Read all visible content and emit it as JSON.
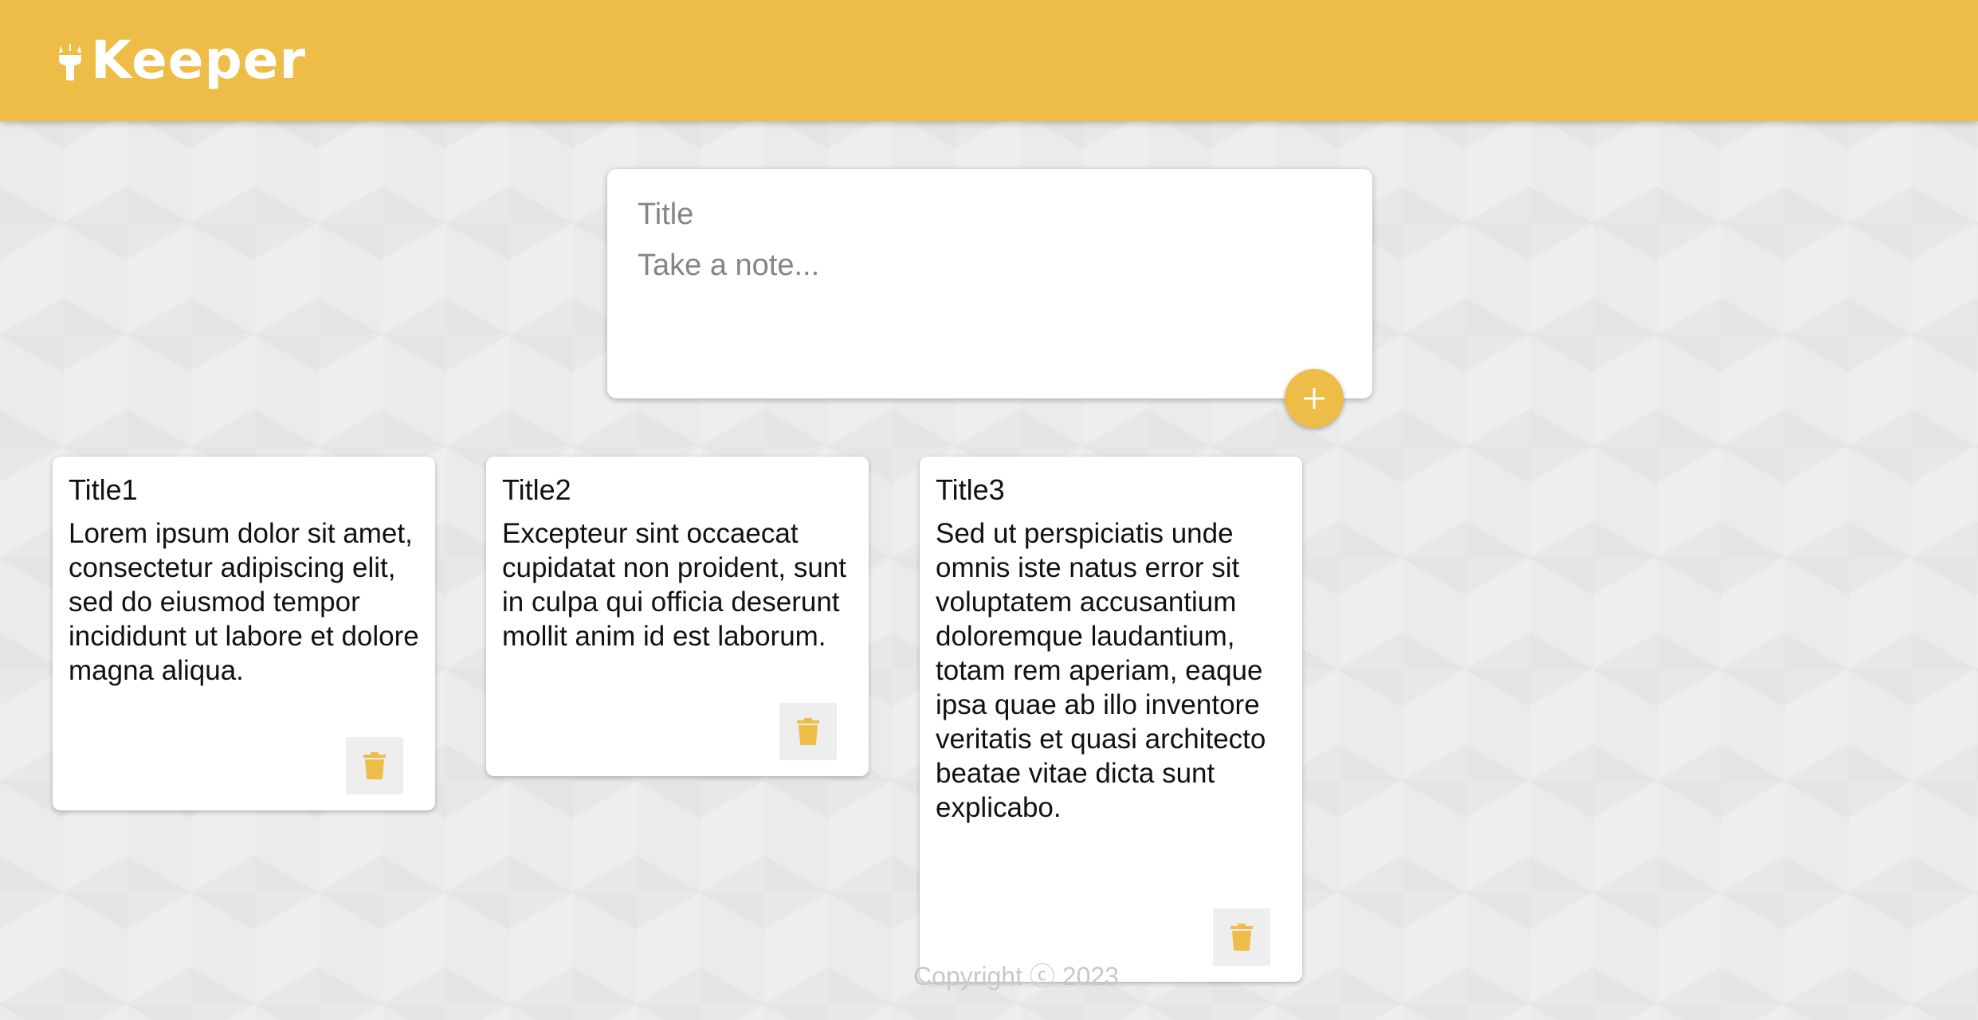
{
  "header": {
    "app_name": "Keeper",
    "logo_icon": "highlight-flashlight-icon",
    "background_color": "#edbd47"
  },
  "create_note": {
    "title_placeholder": "Title",
    "content_placeholder": "Take a note...",
    "title_value": "",
    "content_value": "",
    "add_icon": "plus-icon"
  },
  "notes": [
    {
      "title": "Title1",
      "content": "Lorem ipsum dolor sit amet, consectetur adipiscing elit, sed do eiusmod tempor incididunt ut labore et dolore magna aliqua.",
      "delete_icon": "trash-icon"
    },
    {
      "title": "Title2",
      "content": "Excepteur sint occaecat cupidatat non proident, sunt in culpa qui officia deserunt mollit anim id est laborum.",
      "delete_icon": "trash-icon"
    },
    {
      "title": "Title3",
      "content": "Sed ut perspiciatis unde omnis iste natus error sit voluptatem accusantium doloremque laudantium, totam rem aperiam, eaque ipsa quae ab illo inventore veritatis et quasi architecto beatae vitae dicta sunt explicabo.",
      "delete_icon": "trash-icon"
    }
  ],
  "footer": {
    "copyright": "Copyright ⓒ 2023"
  },
  "colors": {
    "accent": "#edbd47",
    "page_background": "#eeeeee",
    "card_background": "#ffffff"
  }
}
